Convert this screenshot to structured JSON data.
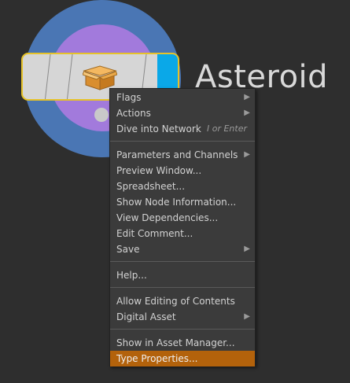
{
  "node": {
    "name": "Asteroid",
    "icon": "asset-box-icon"
  },
  "colors": {
    "background": "#2e2e2e",
    "ring_outer": "#4a76b4",
    "ring_inner": "#a27adc",
    "node_outline": "#e6c228",
    "node_accent": "#0aa8e8",
    "highlight": "#b3620b"
  },
  "context_menu": {
    "items": [
      {
        "label": "Flags",
        "submenu": true
      },
      {
        "label": "Actions",
        "submenu": true
      },
      {
        "label": "Dive into Network",
        "shortcut": "I or Enter"
      },
      {
        "label": "Parameters and Channels",
        "submenu": true
      },
      {
        "label": "Preview Window..."
      },
      {
        "label": "Spreadsheet..."
      },
      {
        "label": "Show Node Information..."
      },
      {
        "label": "View Dependencies..."
      },
      {
        "label": "Edit Comment..."
      },
      {
        "label": "Save",
        "submenu": true
      },
      {
        "label": "Help..."
      },
      {
        "label": "Allow Editing of Contents"
      },
      {
        "label": "Digital Asset",
        "submenu": true
      },
      {
        "label": "Show in Asset Manager..."
      },
      {
        "label": "Type Properties...",
        "highlighted": true
      }
    ],
    "submenu_arrow": "▶"
  }
}
